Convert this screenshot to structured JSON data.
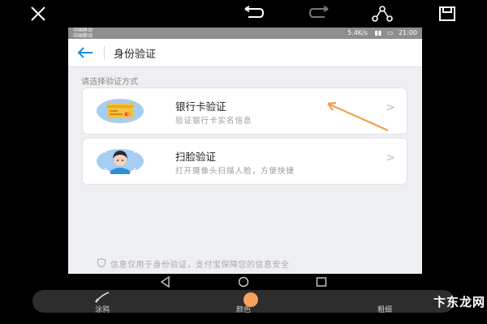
{
  "status_bar": {
    "carrier_line1": "中国移动",
    "carrier_line2": "中国移动",
    "network_speed": "5.4K/s",
    "time": "21:00"
  },
  "header": {
    "title": "身份验证"
  },
  "section_label": "请选择验证方式",
  "options": [
    {
      "title": "银行卡验证",
      "subtitle": "验证银行卡实名信息",
      "chevron": ">"
    },
    {
      "title": "扫脸验证",
      "subtitle": "打开摄像头扫描人脸，方便快捷",
      "chevron": ">"
    }
  ],
  "footer_note": "信息仅用于身份验证，支付宝保障您的信息安全",
  "editor_tools": {
    "doodle_label": "涂鸦",
    "color_label": "颜色",
    "thickness_label": "粗细"
  },
  "watermark": "卞东龙网",
  "colors": {
    "accent_blue": "#1e8ae8",
    "annotation_orange": "#f0a050",
    "page_bg": "#eeeff3"
  }
}
